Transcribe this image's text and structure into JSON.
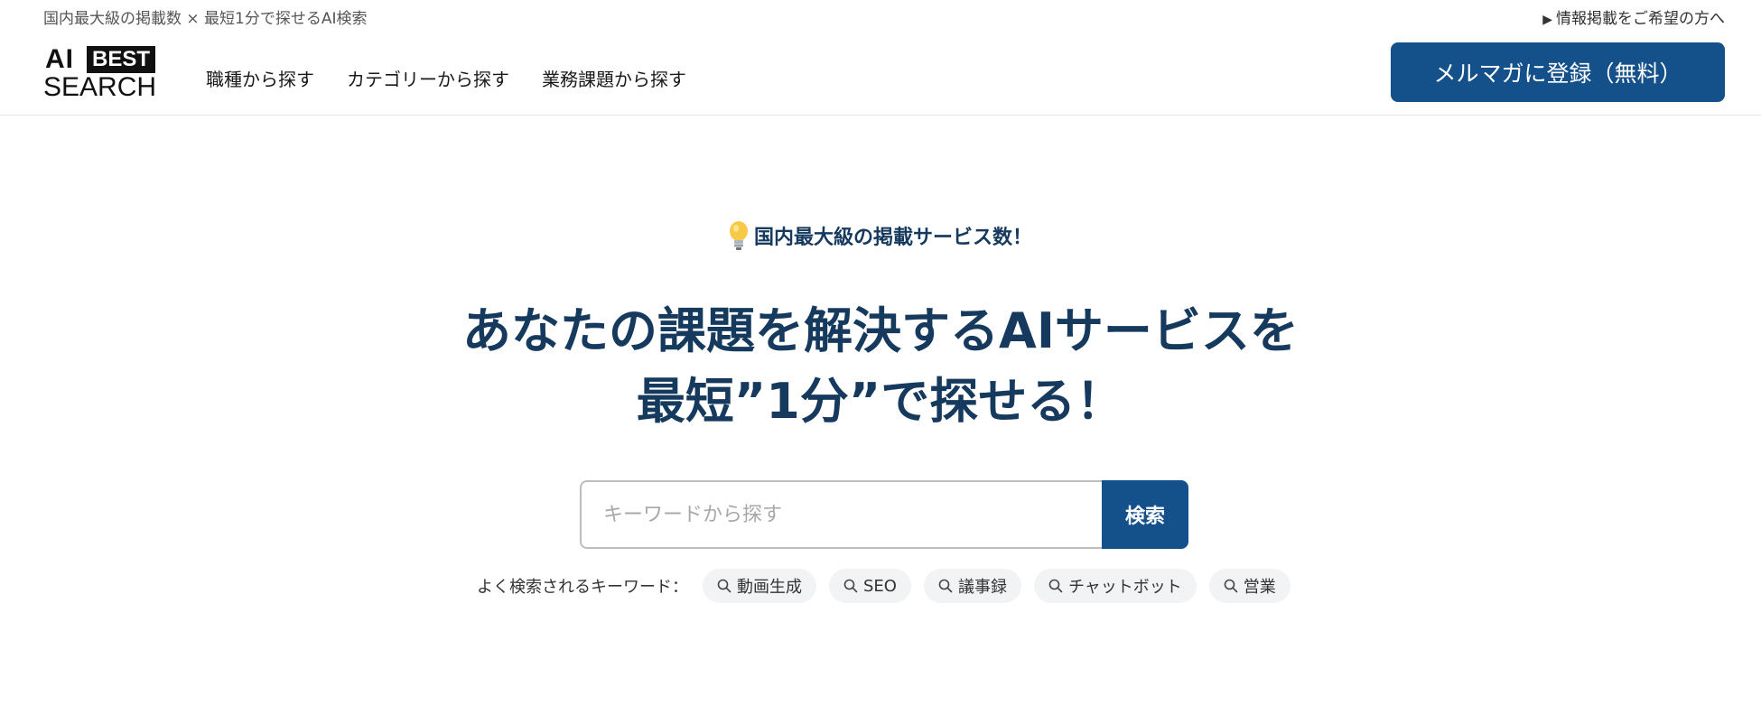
{
  "topbar": {
    "tagline": "国内最大級の掲載数 × 最短1分で探せるAI検索",
    "advertise_link": "情報掲載をご希望の方へ"
  },
  "logo": {
    "line1": "AI",
    "badge": "BEST",
    "line2": "SEARCH"
  },
  "nav": {
    "items": [
      {
        "label": "職種から探す"
      },
      {
        "label": "カテゴリーから探す"
      },
      {
        "label": "業務課題から探す"
      }
    ]
  },
  "cta": {
    "label": "メルマガに登録（無料）"
  },
  "hero": {
    "badge_text": "国内最大級の掲載サービス数！",
    "headline_line1": "あなたの課題を解決するAIサービスを",
    "headline_line2": "最短”1分”で探せる！",
    "accent_color": "#14508a",
    "highlight_color": "#f7d84f",
    "text_color": "#163a5e"
  },
  "search": {
    "placeholder": "キーワードから探す",
    "value": "",
    "button_label": "検索"
  },
  "keywords": {
    "label": "よく検索されるキーワード：",
    "items": [
      {
        "label": "動画生成"
      },
      {
        "label": "SEO"
      },
      {
        "label": "議事録"
      },
      {
        "label": "チャットボット"
      },
      {
        "label": "営業"
      }
    ]
  }
}
